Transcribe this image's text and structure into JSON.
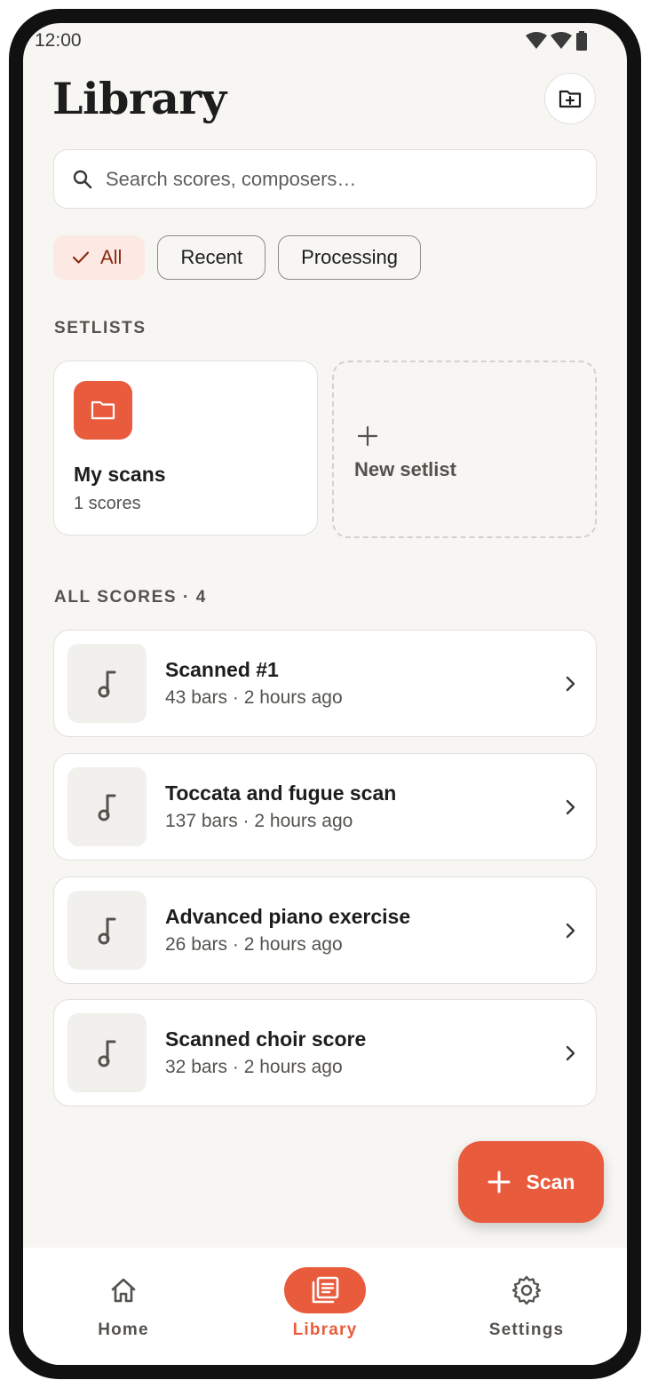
{
  "status_bar": {
    "time": "12:00"
  },
  "header": {
    "title": "Library"
  },
  "search": {
    "placeholder": "Search scores, composers…"
  },
  "filters": [
    {
      "label": "All",
      "selected": true
    },
    {
      "label": "Recent",
      "selected": false
    },
    {
      "label": "Processing",
      "selected": false
    }
  ],
  "setlists": {
    "heading": "SETLISTS",
    "items": [
      {
        "name": "My scans",
        "count": "1 scores"
      }
    ],
    "new_label": "New setlist"
  },
  "scores": {
    "heading": "ALL SCORES · 4",
    "items": [
      {
        "title": "Scanned #1",
        "meta": "43 bars · 2 hours ago"
      },
      {
        "title": "Toccata and fugue scan",
        "meta": "137 bars · 2 hours ago"
      },
      {
        "title": "Advanced piano exercise",
        "meta": "26 bars · 2 hours ago"
      },
      {
        "title": "Scanned choir score",
        "meta": "32 bars · 2 hours ago"
      }
    ]
  },
  "fab": {
    "label": "Scan"
  },
  "nav": [
    {
      "label": "Home",
      "icon": "home-icon",
      "active": false
    },
    {
      "label": "Library",
      "icon": "library-icon",
      "active": true
    },
    {
      "label": "Settings",
      "icon": "gear-icon",
      "active": false
    }
  ],
  "colors": {
    "accent": "#e85b3c",
    "background": "#f7f6f3",
    "chip_active_bg": "#fde9e3"
  }
}
